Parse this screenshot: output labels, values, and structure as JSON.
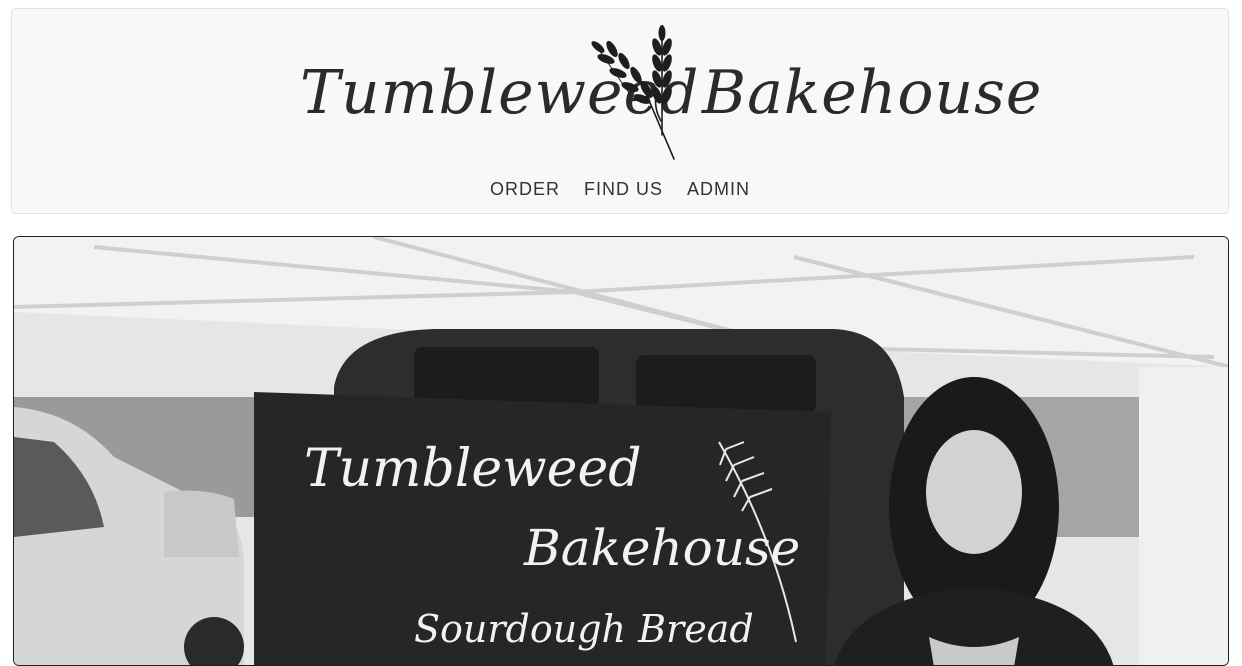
{
  "site": {
    "brand_left": "Tumbleweed",
    "brand_right": "Bakehouse",
    "logo_icon": "wheat-icon"
  },
  "nav": {
    "items": [
      {
        "label": "ORDER"
      },
      {
        "label": "FIND US"
      },
      {
        "label": "ADMIN"
      }
    ]
  },
  "hero": {
    "sign": {
      "line1": "Tumbleweed",
      "line2": "Bakehouse",
      "line3": "Sourdough Bread"
    }
  }
}
